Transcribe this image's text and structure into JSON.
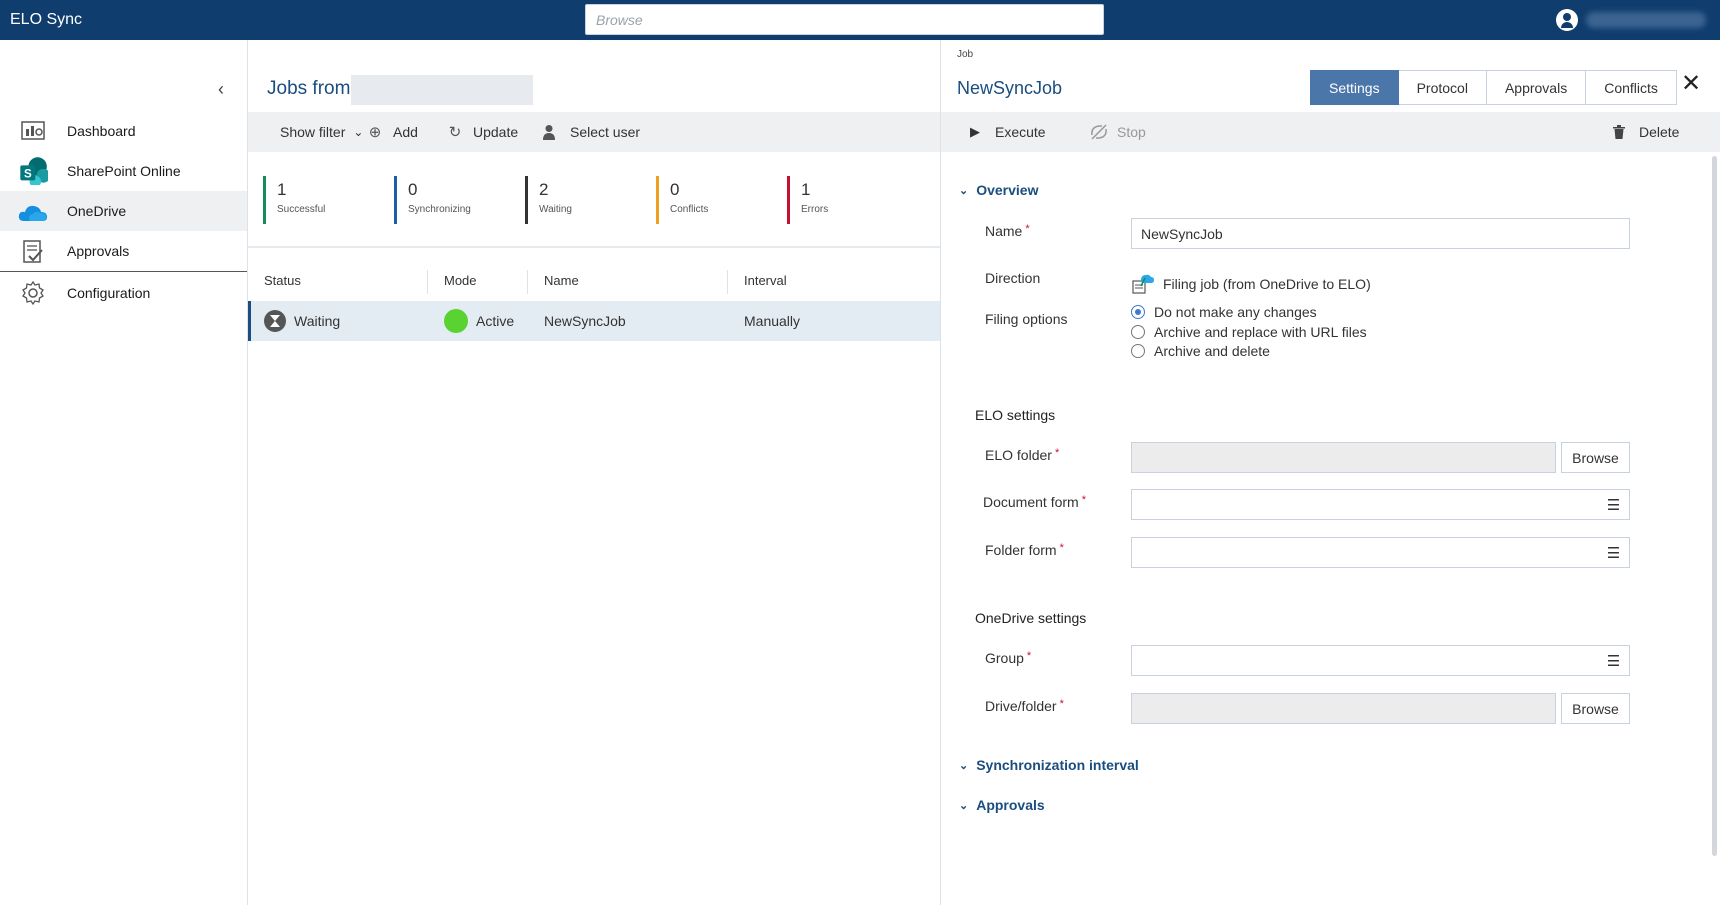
{
  "app": {
    "title": "ELO Sync"
  },
  "search": {
    "placeholder": "Browse"
  },
  "sidebar": {
    "items": [
      {
        "label": "Dashboard",
        "icon": "dashboard-icon"
      },
      {
        "label": "SharePoint Online",
        "icon": "sharepoint-icon"
      },
      {
        "label": "OneDrive",
        "icon": "onedrive-icon",
        "active": true
      },
      {
        "label": "Approvals",
        "icon": "approvals-icon"
      },
      {
        "label": "Configuration",
        "icon": "gear-icon"
      }
    ]
  },
  "jobs": {
    "title": "Jobs from",
    "toolbar": {
      "show_filter": "Show filter",
      "add": "Add",
      "update": "Update",
      "select_user": "Select user"
    },
    "stats": [
      {
        "value": "1",
        "caption": "Successful",
        "color": "#1a8a5a"
      },
      {
        "value": "0",
        "caption": "Synchronizing",
        "color": "#1a5fa8"
      },
      {
        "value": "2",
        "caption": "Waiting",
        "color": "#333333"
      },
      {
        "value": "0",
        "caption": "Conflicts",
        "color": "#f0a020"
      },
      {
        "value": "1",
        "caption": "Errors",
        "color": "#c8102e"
      }
    ],
    "columns": [
      "Status",
      "Mode",
      "Name",
      "Interval"
    ],
    "rows": [
      {
        "status": "Waiting",
        "mode": "Active",
        "name": "NewSyncJob",
        "interval": "Manually"
      }
    ]
  },
  "job": {
    "label": "Job",
    "title": "NewSyncJob",
    "tabs": [
      "Settings",
      "Protocol",
      "Approvals",
      "Conflicts"
    ],
    "selected_tab": "Settings",
    "toolbar": {
      "execute": "Execute",
      "stop": "Stop",
      "delete": "Delete"
    },
    "overview": {
      "header": "Overview",
      "name_label": "Name",
      "name_value": "NewSyncJob",
      "direction_label": "Direction",
      "direction_value": "Filing job (from OneDrive to ELO)",
      "filing_label": "Filing options",
      "filing_options": [
        "Do not make any changes",
        "Archive and replace with URL files",
        "Archive and delete"
      ],
      "filing_selected": 0
    },
    "elo_settings": {
      "header": "ELO settings",
      "folder_label": "ELO folder",
      "docform_label": "Document form",
      "folderform_label": "Folder form",
      "browse": "Browse"
    },
    "onedrive_settings": {
      "header": "OneDrive  settings",
      "group_label": "Group",
      "drive_label": "Drive/folder",
      "browse": "Browse"
    },
    "sections": [
      "Synchronization interval",
      "Approvals"
    ]
  }
}
